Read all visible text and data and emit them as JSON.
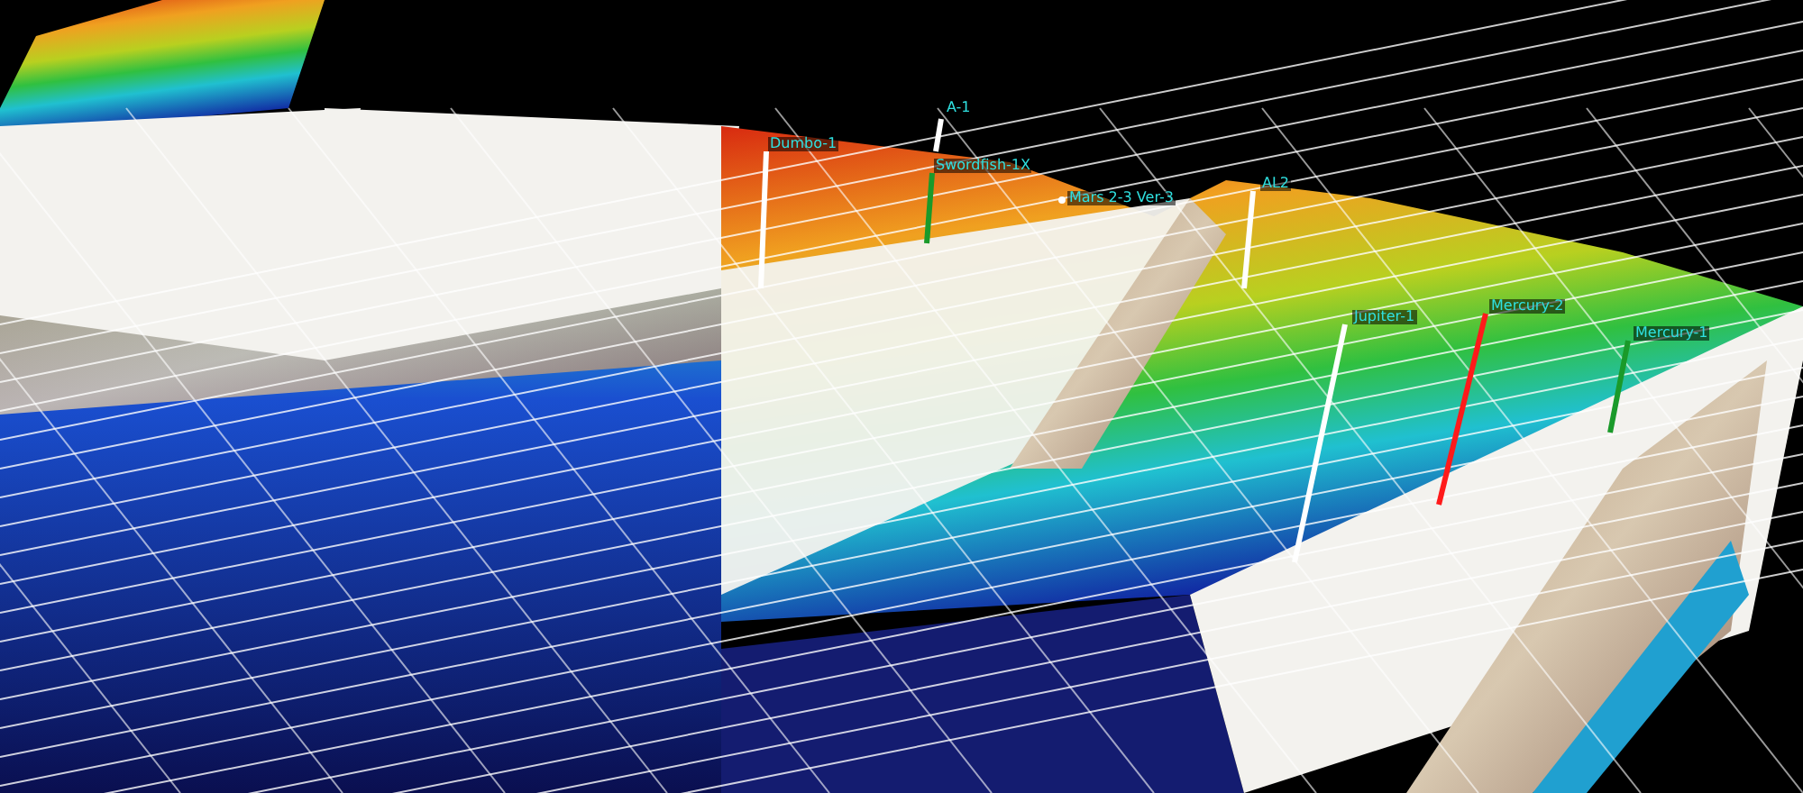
{
  "viewport": {
    "wells": [
      {
        "name": "Dumbo-1",
        "color": "#ffffff"
      },
      {
        "name": "A-1",
        "color": "#ffffff"
      },
      {
        "name": "Swordfish-1X",
        "color": "#1a9a2a"
      },
      {
        "name": "Mars 2-3 Ver-3",
        "color": "#ffffff"
      },
      {
        "name": "AL2",
        "color": "#ffffff"
      },
      {
        "name": "Jupiter-1",
        "color": "#ffffff"
      },
      {
        "name": "Mercury-2",
        "color": "#ff1a1a"
      },
      {
        "name": "Mercury-1",
        "color": "#1a9a2a"
      }
    ]
  }
}
